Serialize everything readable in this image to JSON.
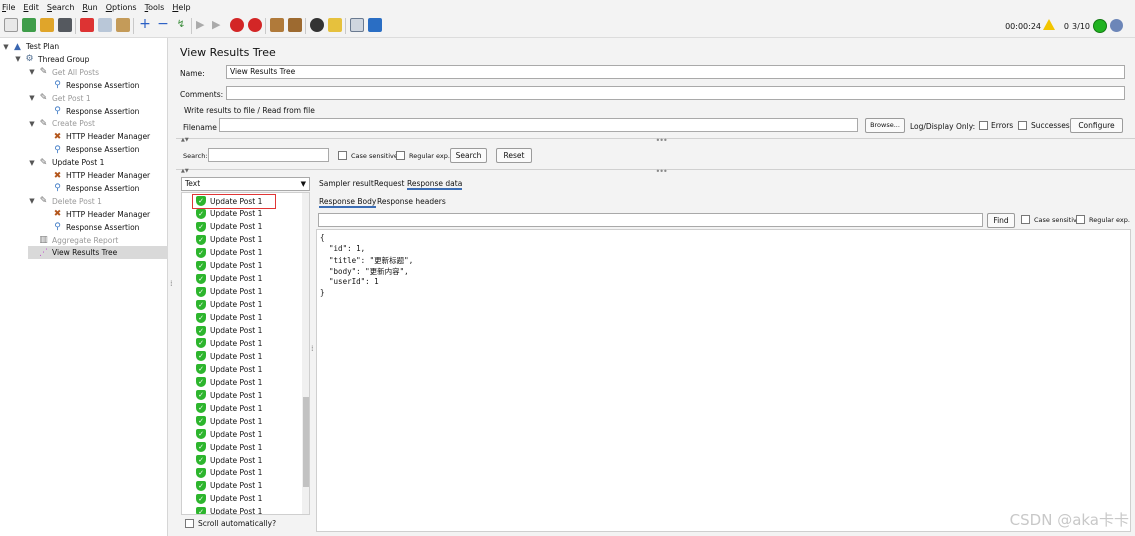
{
  "menu": [
    "File",
    "Edit",
    "Search",
    "Run",
    "Options",
    "Tools",
    "Help"
  ],
  "status": {
    "time": "00:00:24",
    "warnings": "0",
    "threads": "3/10"
  },
  "tree": {
    "items": [
      {
        "label": "Test Plan",
        "icon": "test-plan-icon",
        "twisty": "▼",
        "disabled": false
      },
      {
        "label": "Thread Group",
        "icon": "thread-group-gear-icon",
        "twisty": "▼",
        "disabled": false
      },
      {
        "label": "Get All Posts",
        "icon": "sampler-pencil-icon",
        "twisty": "▼",
        "disabled": true
      },
      {
        "label": "Response Assertion",
        "icon": "assertion-magnifier-icon",
        "twisty": "",
        "disabled": false
      },
      {
        "label": "Get Post 1",
        "icon": "sampler-pencil-icon",
        "twisty": "▼",
        "disabled": true
      },
      {
        "label": "Response Assertion",
        "icon": "assertion-magnifier-icon",
        "twisty": "",
        "disabled": false
      },
      {
        "label": "Create Post",
        "icon": "sampler-pencil-icon",
        "twisty": "▼",
        "disabled": true
      },
      {
        "label": "HTTP Header Manager",
        "icon": "header-manager-tools-icon",
        "twisty": "",
        "disabled": false
      },
      {
        "label": "Response Assertion",
        "icon": "assertion-magnifier-icon",
        "twisty": "",
        "disabled": false
      },
      {
        "label": "Update Post 1",
        "icon": "sampler-pencil-icon",
        "twisty": "▼",
        "disabled": false
      },
      {
        "label": "HTTP Header Manager",
        "icon": "header-manager-tools-icon",
        "twisty": "",
        "disabled": false
      },
      {
        "label": "Response Assertion",
        "icon": "assertion-magnifier-icon",
        "twisty": "",
        "disabled": false
      },
      {
        "label": "Delete Post 1",
        "icon": "sampler-pencil-icon",
        "twisty": "▼",
        "disabled": true
      },
      {
        "label": "HTTP Header Manager",
        "icon": "header-manager-tools-icon",
        "twisty": "",
        "disabled": false
      },
      {
        "label": "Response Assertion",
        "icon": "assertion-magnifier-icon",
        "twisty": "",
        "disabled": false
      },
      {
        "label": "Aggregate Report",
        "icon": "aggregate-report-chart-icon",
        "twisty": "",
        "disabled": true
      },
      {
        "label": "View Results Tree",
        "icon": "results-tree-graph-icon",
        "twisty": "",
        "disabled": false
      }
    ]
  },
  "panel": {
    "title": "View Results Tree",
    "name_label": "Name:",
    "name_value": "View Results Tree",
    "comments_label": "Comments:",
    "comments_value": "",
    "file_section": "Write results to file / Read from file",
    "filename_label": "Filename",
    "filename_value": "",
    "browse": "Browse...",
    "log_display": "Log/Display Only:",
    "errors": "Errors",
    "successes": "Successes",
    "configure": "Configure",
    "search_label": "Search:",
    "search_value": "",
    "case_sensitive": "Case sensitive",
    "regular_exp": "Regular exp.",
    "search_button": "Search",
    "reset_button": "Reset",
    "renderer": "Text",
    "scroll_auto": "Scroll automatically?",
    "result_label": "Update Post 1",
    "result_count": 25,
    "tabs": [
      "Sampler result",
      "Request",
      "Response data"
    ],
    "subtabs": [
      "Response Body",
      "Response headers"
    ],
    "find_value": "",
    "find_button": "Find",
    "find_case": "Case sensitive",
    "find_regex": "Regular exp.",
    "response_lines": [
      "{",
      "  \"id\": 1,",
      "  \"title\": \"更新标题\",",
      "  \"body\": \"更新内容\",",
      "  \"userId\": 1",
      "}"
    ]
  },
  "watermark": "CSDN @aka卡卡"
}
